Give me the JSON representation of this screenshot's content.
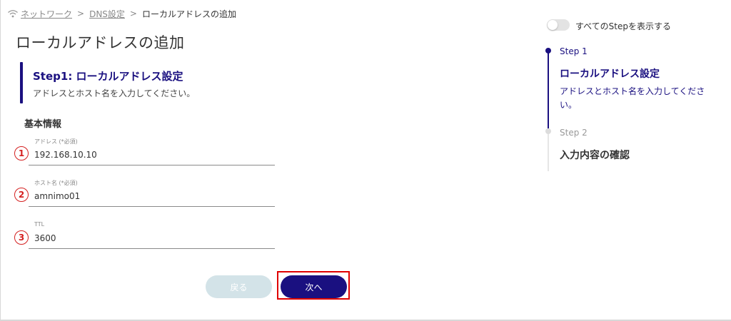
{
  "breadcrumb": {
    "home_icon": "wifi-icon",
    "items": [
      "ネットワーク",
      "DNS設定",
      "ローカルアドレスの追加"
    ],
    "separator": ">"
  },
  "page": {
    "title": "ローカルアドレスの追加"
  },
  "step": {
    "title": "Step1: ローカルアドレス設定",
    "description": "アドレスとホスト名を入力してください。"
  },
  "section": {
    "title": "基本情報"
  },
  "fields": [
    {
      "marker": "1",
      "label": "アドレス (*必須)",
      "value": "192.168.10.10"
    },
    {
      "marker": "2",
      "label": "ホスト名 (*必須)",
      "value": "amnimo01"
    },
    {
      "marker": "3",
      "label": "TTL",
      "value": "3600"
    }
  ],
  "buttons": {
    "back": "戻る",
    "next": "次へ"
  },
  "sidebar": {
    "toggle_label": "すべてのStepを表示する",
    "toggle_on": false,
    "steps": [
      {
        "label": "Step 1",
        "title": "ローカルアドレス設定",
        "description": "アドレスとホスト名を入力してください。",
        "active": true
      },
      {
        "label": "Step 2",
        "title": "入力内容の確認",
        "active": false
      }
    ]
  },
  "colors": {
    "accent": "#1a1080",
    "highlight": "#e00000",
    "annotation": "#d42020",
    "back_button": "#d3e3e8"
  }
}
